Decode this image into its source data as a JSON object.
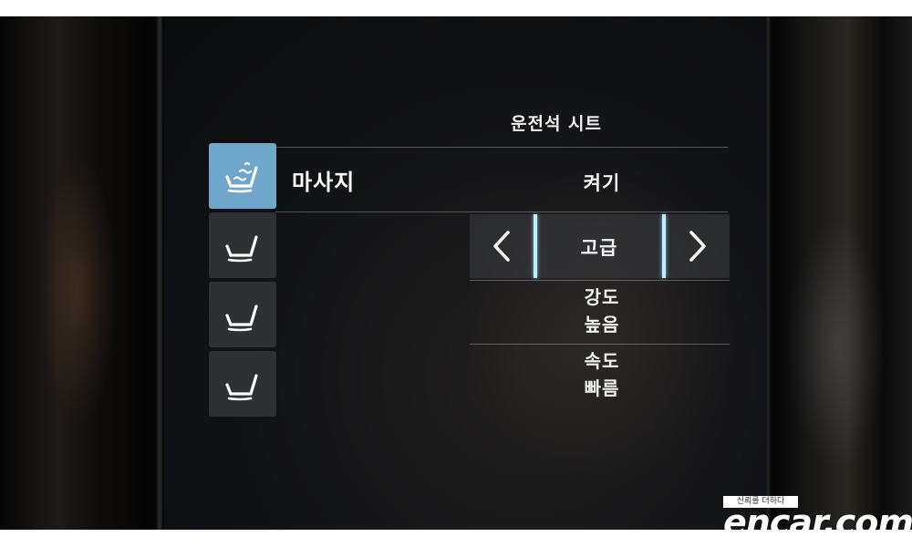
{
  "screen": {
    "title": "운전석 시트",
    "function_label": "마사지",
    "status_value": "켜기",
    "program": {
      "value": "고급",
      "prev_icon": "chevron-left-icon",
      "next_icon": "chevron-right-icon"
    },
    "intensity": {
      "label": "강도",
      "value": "높음"
    },
    "speed": {
      "label": "속도",
      "value": "빠름"
    }
  },
  "seat_tabs": [
    {
      "icon": "seat-massage-icon",
      "active": true
    },
    {
      "icon": "seat-icon",
      "active": false
    },
    {
      "icon": "seat-icon",
      "active": false
    },
    {
      "icon": "seat-icon",
      "active": false
    }
  ],
  "colors": {
    "active_tab": "#6fa6cc",
    "inactive_tab": "#2e3033",
    "accent_bar": "#bfeeff",
    "text": "#f2f2f2"
  },
  "watermark": {
    "tagline": "신뢰를 더하다",
    "brand": "encar.com"
  }
}
